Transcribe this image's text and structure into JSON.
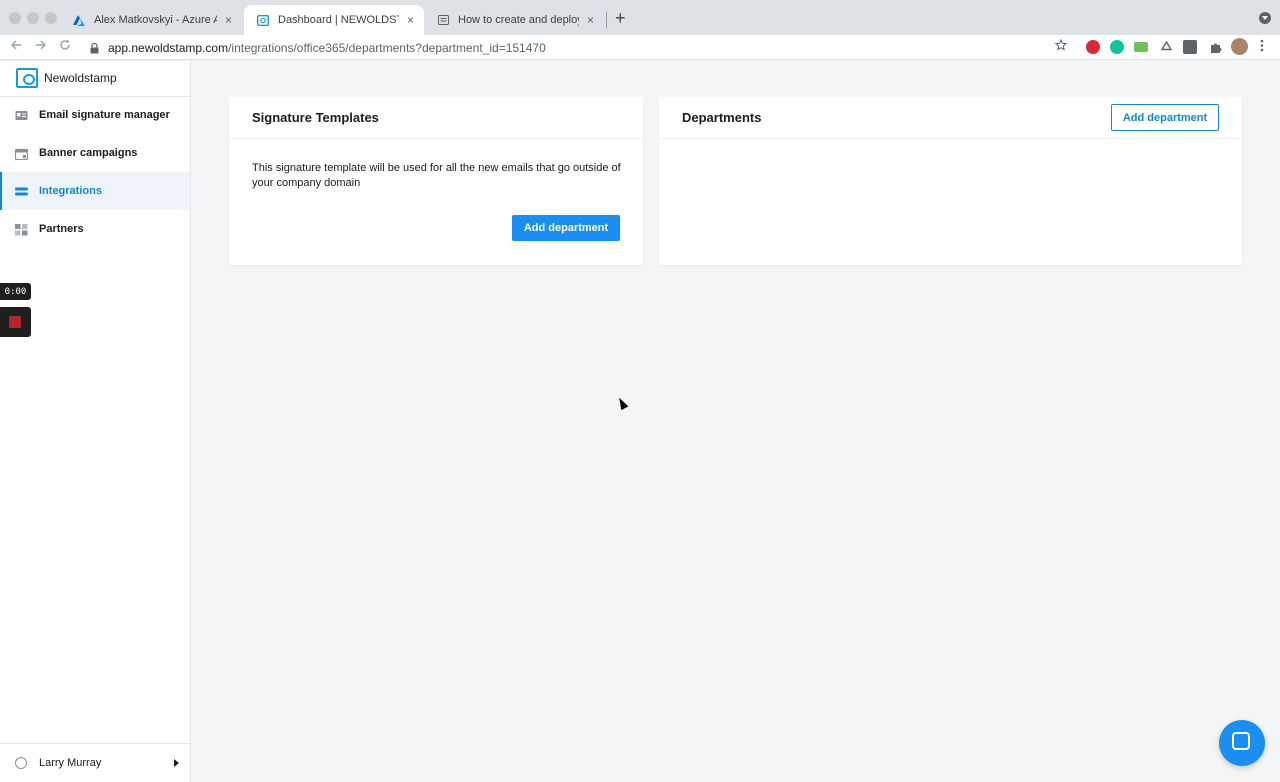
{
  "browser": {
    "tabs": [
      {
        "title": "Alex Matkovskyi - Azure Active Directory"
      },
      {
        "title": "Dashboard | NEWOLDSTAMP"
      },
      {
        "title": "How to create and deploy a company signature"
      }
    ],
    "new_tab_symbol": "+",
    "close_symbol": "×",
    "url_host": "app.newoldstamp.com",
    "url_path": "/integrations/office365/departments?department_id=151470",
    "extensions": [
      "adblock-icon",
      "grammarly-icon",
      "mail-icon",
      "recycle-icon",
      "s-icon",
      "puzzle-icon",
      "profile-icon"
    ],
    "accent_color": "#1a8ff1"
  },
  "sidebar": {
    "brand": "Newoldstamp",
    "items": [
      {
        "label": "Email signature manager",
        "icon": "id-card-icon",
        "active": false
      },
      {
        "label": "Banner campaigns",
        "icon": "calendar-icon",
        "active": false
      },
      {
        "label": "Integrations",
        "icon": "toggles-icon",
        "active": true
      },
      {
        "label": "Partners",
        "icon": "grid-icon",
        "active": false
      }
    ],
    "user_name": "Larry Murray"
  },
  "recorder": {
    "timer": "0:00"
  },
  "signature_card": {
    "title": "Signature Templates",
    "text": "This signature template will be used for all the new emails that go outside of your company domain",
    "button_label": "Add department"
  },
  "departments_card": {
    "title": "Departments",
    "button_label": "Add department"
  }
}
